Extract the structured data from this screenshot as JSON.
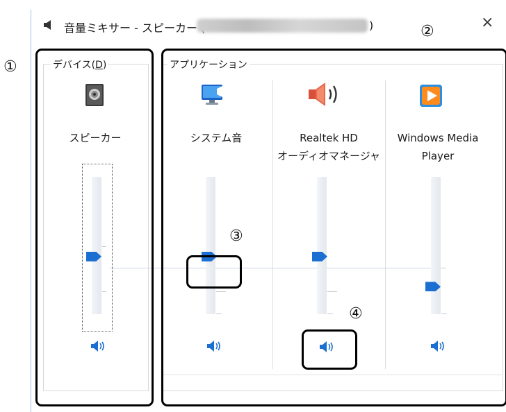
{
  "window": {
    "title_prefix": "音量ミキサー - スピーカー (",
    "title_device_blurred": "Realtek High Definition Audio",
    "title_suffix": ")",
    "close_glyph": "×"
  },
  "device_group": {
    "label_main": "デバイス(",
    "label_accel": "D",
    "label_end": ")",
    "device": {
      "name": "スピーカー",
      "icon": "speaker-device-icon",
      "volume": 0.42,
      "mute_icon": "volume-icon"
    }
  },
  "apps_group": {
    "label": "アプリケーション",
    "apps": [
      {
        "line1": "システム音",
        "line2": "",
        "icon": "system-sounds-icon",
        "volume": 0.42,
        "mute_icon": "volume-icon"
      },
      {
        "line1": "Realtek HD",
        "line2": "オーディオマネージャ",
        "icon": "realtek-speaker-icon",
        "volume": 0.42,
        "mute_icon": "volume-icon"
      },
      {
        "line1": "Windows Media",
        "line2": "Player",
        "icon": "windows-media-player-icon",
        "volume": 0.2,
        "mute_icon": "volume-icon"
      }
    ]
  },
  "callouts": [
    "①",
    "②",
    "③",
    "④"
  ],
  "colors": {
    "accent": "#1a6fd0",
    "outline": "#000000"
  }
}
